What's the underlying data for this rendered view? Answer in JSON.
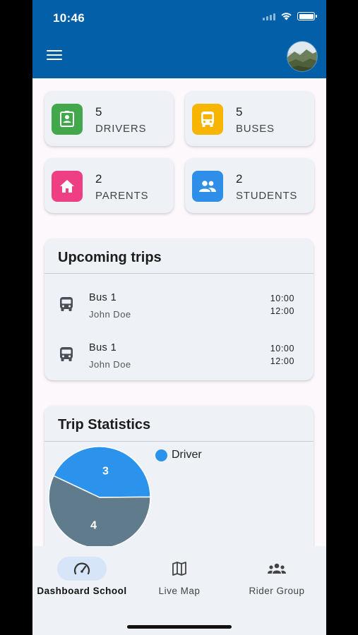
{
  "status_bar": {
    "time": "10:46"
  },
  "colors": {
    "appbar": "#035fa7",
    "drivers": "#43a74b",
    "buses": "#f7b500",
    "parents": "#ee3f84",
    "students": "#2f8fe8",
    "pie_driver": "#2b93ec",
    "pie_other": "#5f7b8c"
  },
  "appbar": {
    "menu_icon": "menu-icon",
    "avatar": "avatar"
  },
  "stats": [
    {
      "count": "5",
      "label": "DRIVERS",
      "icon": "driver-badge-icon"
    },
    {
      "count": "5",
      "label": "BUSES",
      "icon": "bus-icon"
    },
    {
      "count": "2",
      "label": "PARENTS",
      "icon": "home-icon"
    },
    {
      "count": "2",
      "label": "STUDENTS",
      "icon": "group-icon"
    }
  ],
  "upcoming": {
    "title": "Upcoming trips",
    "trips": [
      {
        "bus": "Bus 1",
        "driver": "John Doe",
        "start": "10:00",
        "end": "12:00"
      },
      {
        "bus": "Bus 1",
        "driver": "John Doe",
        "start": "10:00",
        "end": "12:00"
      }
    ]
  },
  "trip_statistics": {
    "title": "Trip Statistics",
    "legend": [
      "Driver"
    ]
  },
  "chart_data": {
    "type": "pie",
    "title": "Trip Statistics",
    "slices": [
      {
        "name": "Driver",
        "value": 3,
        "label": "3",
        "color": "#2b93ec"
      },
      {
        "name": "",
        "value": 4,
        "label": "4",
        "color": "#5f7b8c"
      }
    ]
  },
  "bottom_nav": [
    {
      "label": "Dashboard School",
      "icon": "speedometer-icon",
      "active": true
    },
    {
      "label": "Live Map",
      "icon": "map-icon",
      "active": false
    },
    {
      "label": "Rider Group",
      "icon": "group-icon",
      "active": false
    }
  ]
}
